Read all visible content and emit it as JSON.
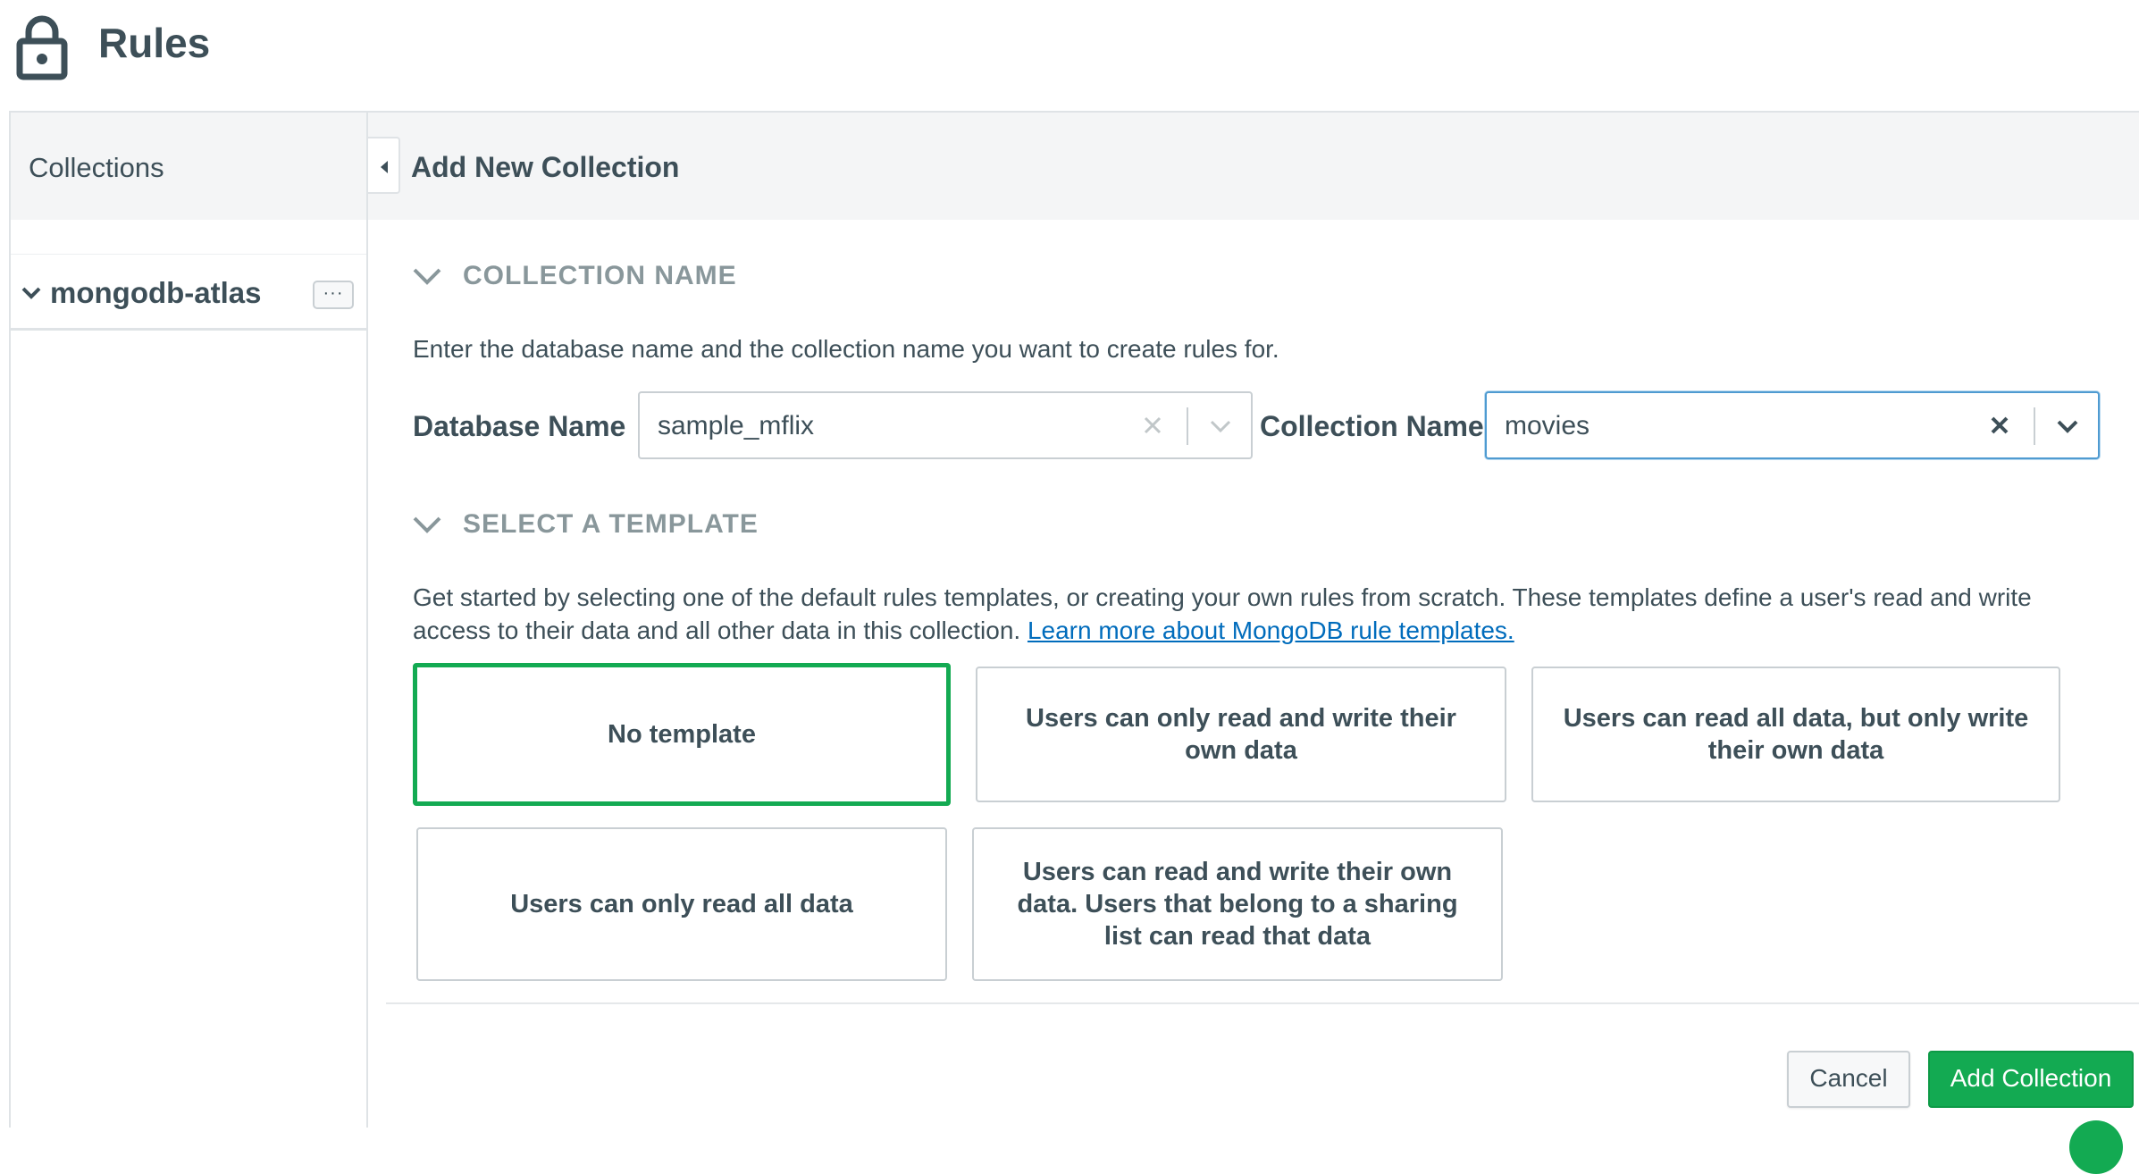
{
  "header": {
    "title": "Rules",
    "icon": "lock-icon"
  },
  "sidebar": {
    "title": "Collections",
    "databases": [
      {
        "name": "mongodb-atlas",
        "menu_label": "···"
      }
    ]
  },
  "main": {
    "title": "Add New Collection",
    "collection_section": {
      "title": "COLLECTION NAME",
      "description": "Enter the database name and the collection name you want to create rules for.",
      "database_label": "Database Name",
      "database_value": "sample_mflix",
      "collection_label": "Collection Name",
      "collection_value": "movies"
    },
    "template_section": {
      "title": "SELECT A TEMPLATE",
      "description": "Get started by selecting one of the default rules templates, or creating your own rules from scratch. These templates define a user's read and write access to their data and all other data in this collection.",
      "link_text": "Learn more about MongoDB rule templates.",
      "templates": [
        {
          "label": "No template",
          "selected": true
        },
        {
          "label": "Users can only read and write their own data",
          "selected": false
        },
        {
          "label": "Users can read all data, but only write their own data",
          "selected": false
        },
        {
          "label": "Users can only read all data",
          "selected": false
        },
        {
          "label": "Users can read and write their own data. Users that belong to a sharing list can read that data",
          "selected": false
        }
      ]
    },
    "footer": {
      "cancel_label": "Cancel",
      "submit_label": "Add Collection"
    }
  },
  "colors": {
    "accent": "#13aa52",
    "link": "#006cbc",
    "focus": "#4f9bd1",
    "text": "#3d4f58",
    "muted": "#89979b"
  }
}
